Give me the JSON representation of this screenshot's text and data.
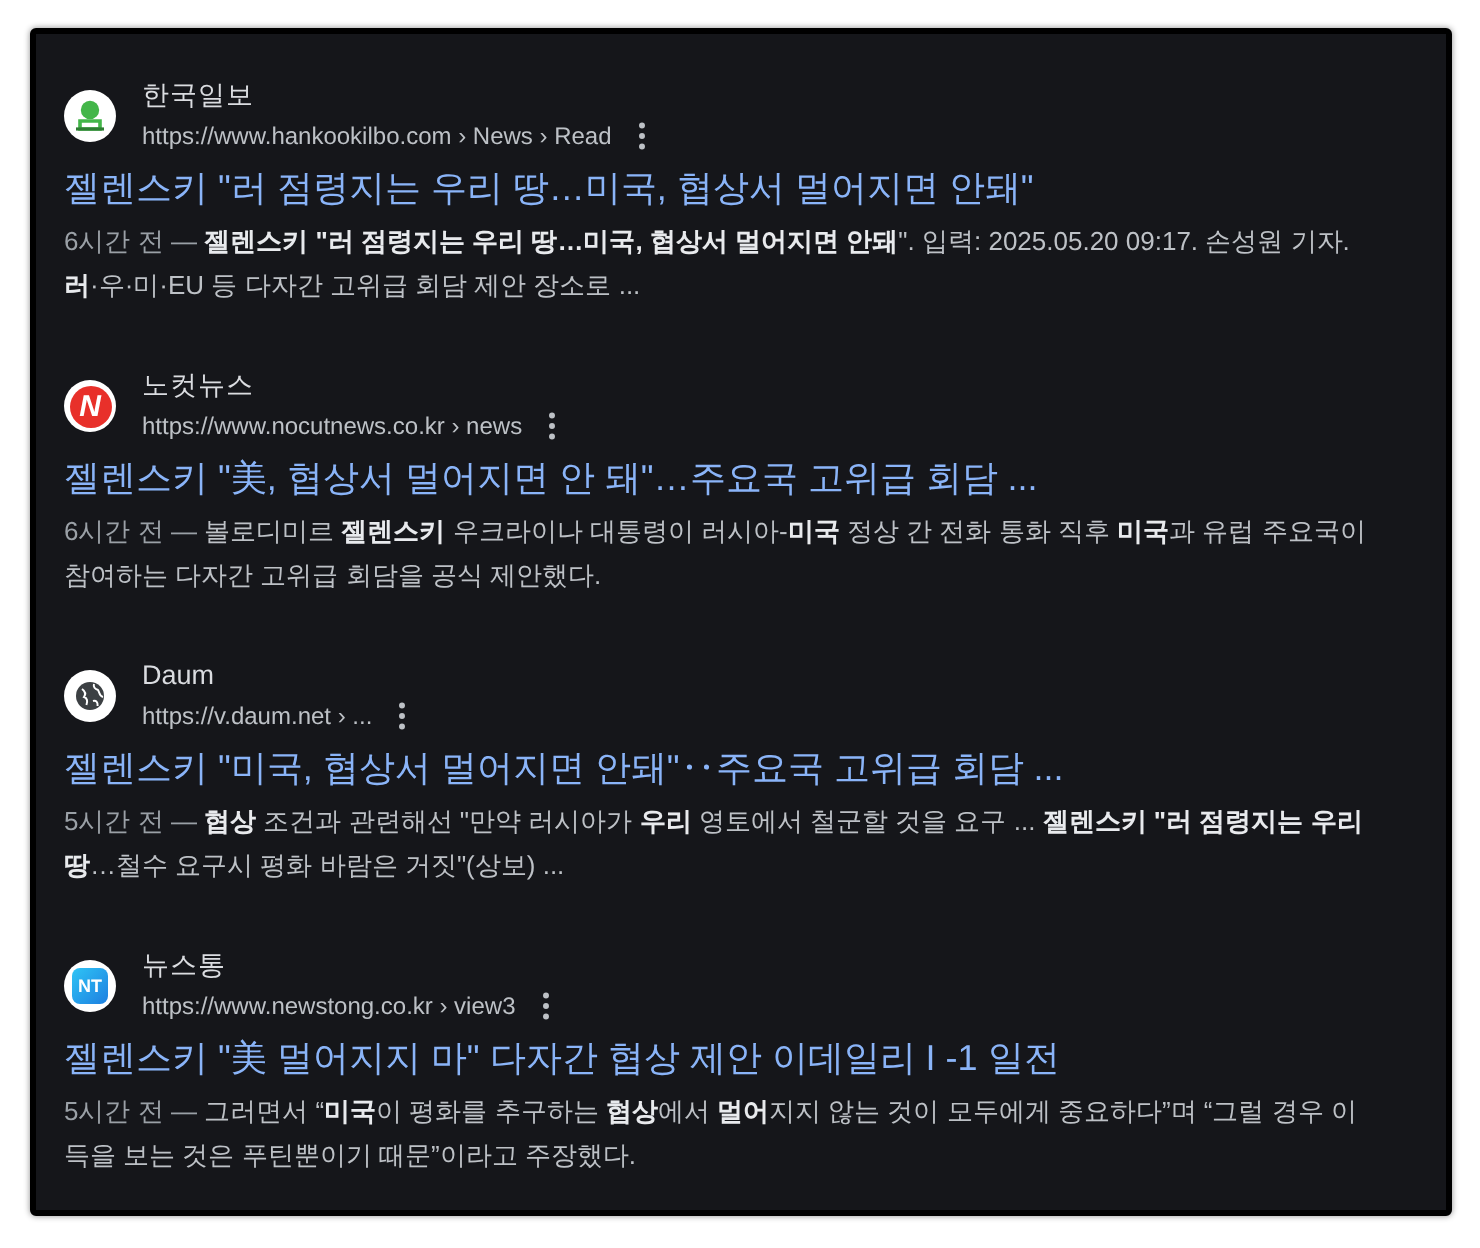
{
  "results": [
    {
      "source": "한국일보",
      "url": "https://www.hankookilbo.com › News › Read",
      "logo": {
        "kind": "stamp"
      },
      "title": "젤렌스키 \"러 점령지는 우리 땅…미국, 협상서 멀어지면 안돼\"",
      "age": "6시간 전 —",
      "snippet": "**젤렌스키 \"러 점령지는 우리 땅…미국, 협상서 멀어지면 안돼**\". 입력: 2025.05.20 09:17. 손성원 기자. **러**·우·미·EU 등 다자간 고위급 회담 제안 장소로 ..."
    },
    {
      "source": "노컷뉴스",
      "url": "https://www.nocutnews.co.kr › news",
      "logo": {
        "kind": "letter",
        "text": "N"
      },
      "title": "젤렌스키 \"美, 협상서 멀어지면 안 돼\"…주요국 고위급 회담 ...",
      "age": "6시간 전 —",
      "snippet": "볼로디미르 **젤렌스키** 우크라이나 대통령이 러시아-**미국** 정상 간 전화 통화 직후 **미국**과 유럽 주요국이 참여하는 다자간 고위급 회담을 공식 제안했다."
    },
    {
      "source": "Daum",
      "url": "https://v.daum.net › ...",
      "logo": {
        "kind": "globe"
      },
      "title": "젤렌스키 \"미국, 협상서 멀어지면 안돼\"‥주요국 고위급 회담 ...",
      "age": "5시간 전 —",
      "snippet": "**협상** 조건과 관련해선 \"만약 러시아가 **우리** 영토에서 철군할 것을 요구 ... **젤렌스키 \"러 점령지는 우리 땅**…철수 요구시 평화 바람은 거짓\"(상보) ..."
    },
    {
      "source": "뉴스통",
      "url": "https://www.newstong.co.kr › view3",
      "logo": {
        "kind": "tile",
        "text": "NT"
      },
      "title": "젤렌스키 \"美 멀어지지 마\" 다자간 협상 제안 이데일리 I -1 일전",
      "age": "5시간 전 —",
      "snippet": "그러면서 “**미국**이 평화를 추구하는 **협상**에서 **멀어**지지 않는 것이 모두에게 중요하다”며 “그럴 경우 이득을 보는 것은 푸틴뿐이기 때문”이라고 주장했다."
    }
  ]
}
